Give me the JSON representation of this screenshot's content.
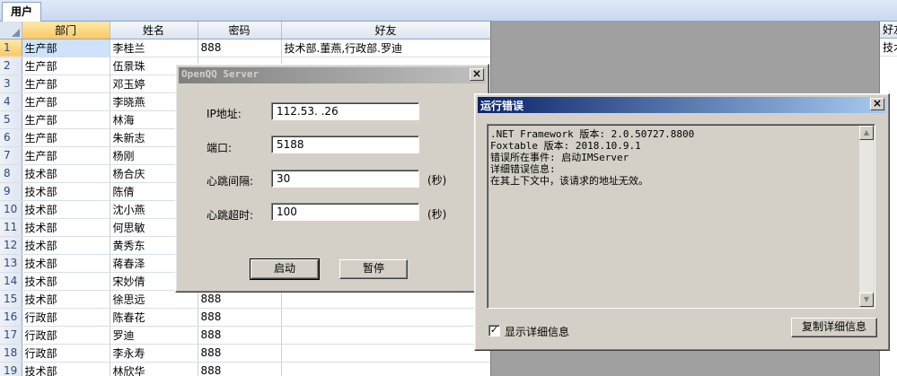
{
  "tabs": [
    {
      "label": "用户"
    }
  ],
  "grid": {
    "columns": [
      "部门",
      "姓名",
      "密码",
      "好友"
    ],
    "rows": [
      {
        "num": "1",
        "dept": "生产部",
        "name": "李桂兰",
        "pwd": "888",
        "friends": "技术部.董燕,行政部.罗迪"
      },
      {
        "num": "2",
        "dept": "生产部",
        "name": "伍景珠",
        "pwd": "",
        "friends": ""
      },
      {
        "num": "3",
        "dept": "生产部",
        "name": "邓玉婷",
        "pwd": "",
        "friends": ""
      },
      {
        "num": "4",
        "dept": "生产部",
        "name": "李晓燕",
        "pwd": "",
        "friends": ""
      },
      {
        "num": "5",
        "dept": "生产部",
        "name": "林海",
        "pwd": "",
        "friends": ""
      },
      {
        "num": "6",
        "dept": "生产部",
        "name": "朱新志",
        "pwd": "",
        "friends": ""
      },
      {
        "num": "7",
        "dept": "生产部",
        "name": "杨刚",
        "pwd": "",
        "friends": ""
      },
      {
        "num": "8",
        "dept": "技术部",
        "name": "杨合庆",
        "pwd": "",
        "friends": ""
      },
      {
        "num": "9",
        "dept": "技术部",
        "name": "陈倩",
        "pwd": "",
        "friends": ""
      },
      {
        "num": "10",
        "dept": "技术部",
        "name": "沈小燕",
        "pwd": "",
        "friends": ""
      },
      {
        "num": "11",
        "dept": "技术部",
        "name": "何思敏",
        "pwd": "",
        "friends": ""
      },
      {
        "num": "12",
        "dept": "技术部",
        "name": "黄秀东",
        "pwd": "",
        "friends": ""
      },
      {
        "num": "13",
        "dept": "技术部",
        "name": "蒋春泽",
        "pwd": "",
        "friends": ""
      },
      {
        "num": "14",
        "dept": "技术部",
        "name": "宋妙倩",
        "pwd": "",
        "friends": ""
      },
      {
        "num": "15",
        "dept": "技术部",
        "name": "徐思远",
        "pwd": "888",
        "friends": ""
      },
      {
        "num": "16",
        "dept": "行政部",
        "name": "陈春花",
        "pwd": "888",
        "friends": ""
      },
      {
        "num": "17",
        "dept": "行政部",
        "name": "罗迪",
        "pwd": "888",
        "friends": ""
      },
      {
        "num": "18",
        "dept": "行政部",
        "name": "李永寿",
        "pwd": "888",
        "friends": ""
      },
      {
        "num": "19",
        "dept": "技术部",
        "name": "林欣华",
        "pwd": "888",
        "friends": ""
      }
    ]
  },
  "grid2": {
    "header": "好友",
    "rows": [
      "技术"
    ]
  },
  "server_dialog": {
    "title": "OpenQQ Server",
    "ip_label": "IP地址:",
    "ip_value": "112.53.     .26",
    "port_label": "端口:",
    "port_value": "5188",
    "heartbeat_interval_label": "心跳间隔:",
    "heartbeat_interval_value": "30",
    "heartbeat_timeout_label": "心跳超时:",
    "heartbeat_timeout_value": "100",
    "unit": "(秒)",
    "start_button": "启动",
    "pause_button": "暂停"
  },
  "error_dialog": {
    "title": "运行错误",
    "lines": [
      ".NET Framework 版本: 2.0.50727.8800",
      "Foxtable 版本: 2018.10.9.1",
      "错误所在事件: 启动IMServer",
      "详细错误信息:",
      "在其上下文中，该请求的地址无效。"
    ],
    "show_details_label": "显示详细信息",
    "show_details_checked": true,
    "copy_button": "复制详细信息"
  },
  "colors": {
    "title_gradient_start": "#0a246a",
    "title_gradient_end": "#a6caf0",
    "inactive_title_start": "#808080",
    "inactive_title_end": "#c0c0c0"
  }
}
